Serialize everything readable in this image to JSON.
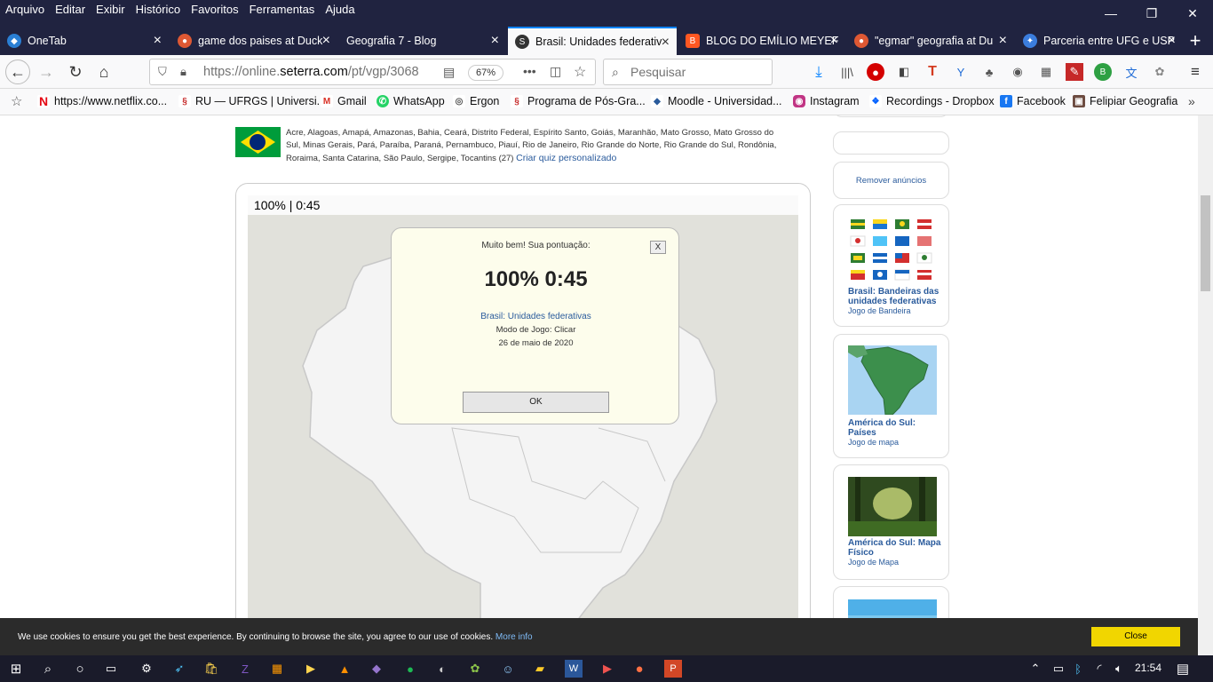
{
  "menu": [
    "Arquivo",
    "Editar",
    "Exibir",
    "Histórico",
    "Favoritos",
    "Ferramentas",
    "Ajuda"
  ],
  "tabs": [
    {
      "label": "OneTab",
      "active": false,
      "color": "#2a7fd4"
    },
    {
      "label": "game dos paises at Duck",
      "active": false,
      "color": "#de5833"
    },
    {
      "label": "Geografia 7 - Blog",
      "active": false,
      "color": "#202340"
    },
    {
      "label": "Brasil: Unidades federativ",
      "active": true,
      "color": "#333"
    },
    {
      "label": "BLOG DO EMÍLIO MEYEF",
      "active": false,
      "color": "#ff5722"
    },
    {
      "label": "\"egmar\" geografia at Du",
      "active": false,
      "color": "#de5833"
    },
    {
      "label": "Parceria entre UFG e USP",
      "active": false,
      "color": "#3b7ddd"
    }
  ],
  "navbar": {
    "url_prefix": "https://online.",
    "url_domain": "seterra.com",
    "url_path": "/pt/vgp/3068",
    "zoom": "67%",
    "search_placeholder": "Pesquisar"
  },
  "bookmarks": [
    {
      "label": "https://www.netflix.co...",
      "color": "#e50914",
      "glyph": "N"
    },
    {
      "label": "RU — UFRGS | Universi...",
      "color": "#c62828",
      "glyph": "§"
    },
    {
      "label": "Gmail",
      "color": "#d93025",
      "glyph": "M"
    },
    {
      "label": "WhatsApp",
      "color": "#25d366",
      "glyph": "✆"
    },
    {
      "label": "Ergon",
      "color": "#555",
      "glyph": "◎"
    },
    {
      "label": "Programa de Pós-Gra...",
      "color": "#c62828",
      "glyph": "§"
    },
    {
      "label": "Moodle - Universidad...",
      "color": "#2a5b9c",
      "glyph": "◆"
    },
    {
      "label": "Instagram",
      "color": "#c13584",
      "glyph": "◉"
    },
    {
      "label": "Recordings - Dropbox",
      "color": "#0061ff",
      "glyph": "❖"
    },
    {
      "label": "Facebook",
      "color": "#1877f2",
      "glyph": "f"
    },
    {
      "label": "Felipiar Geografia",
      "color": "#6d4c41",
      "glyph": "▣"
    }
  ],
  "game": {
    "states_text": "Acre, Alagoas, Amapá, Amazonas, Bahia, Ceará, Distrito Federal, Espírito Santo, Goiás, Maranhão, Mato Grosso, Mato Grosso do Sul, Minas Gerais, Pará, Paraíba, Paraná, Pernambuco, Piauí, Rio de Janeiro, Rio Grande do Norte, Rio Grande do Sul, Rondônia, Roraima, Santa Catarina, São Paulo, Sergipe, Tocantins (27)",
    "custom_quiz_link": "Criar quiz personalizado",
    "status_bar": "100% | 0:45"
  },
  "dialog": {
    "heading": "Muito bem! Sua pontuação:",
    "score": "100% 0:45",
    "quiz_link": "Brasil: Unidades federativas",
    "mode": "Modo de Jogo: Clicar",
    "date": "26 de maio de 2020",
    "ok_label": "OK",
    "close_label": "X"
  },
  "sidebar": {
    "remove_ads": "Remover anúncios",
    "cards": [
      {
        "title": "Brasil: Bandeiras das unidades federativas",
        "subtitle": "Jogo de Bandeira"
      },
      {
        "title": "América do Sul: Países",
        "subtitle": "Jogo de mapa"
      },
      {
        "title": "América do Sul: Mapa Físico",
        "subtitle": "Jogo de Mapa"
      }
    ]
  },
  "cookie": {
    "text": "We use cookies to ensure you get the best experience. By continuing to browse the site, you agree to our use of cookies.",
    "more_info": "More info",
    "close_label": "Close"
  },
  "taskbar": {
    "clock": "21:54"
  }
}
